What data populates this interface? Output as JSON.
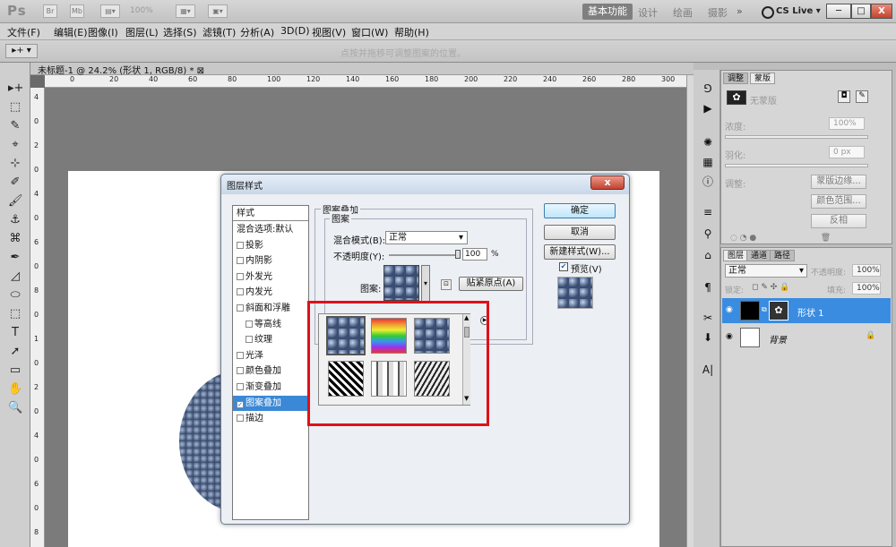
{
  "app": {
    "logo": "Ps",
    "zoom": "100%",
    "workspaces": [
      "基本功能",
      "设计",
      "绘画",
      "摄影"
    ],
    "more": "»",
    "cslive": "CS Live ▾",
    "win_min": "─",
    "win_max": "□",
    "win_close": "X"
  },
  "menu": [
    "文件(F)",
    "编辑(E)",
    "图像(I)",
    "图层(L)",
    "选择(S)",
    "滤镜(T)",
    "分析(A)",
    "3D(D)",
    "视图(V)",
    "窗口(W)",
    "帮助(H)"
  ],
  "options": {
    "tool": "▸+ ▾",
    "hint": "点按并拖移可调整图案的位置。"
  },
  "document": {
    "tab": "未标题-1 @ 24.2% (形状 1, RGB/8) * ⊠",
    "ruler_h": [
      "0",
      "20",
      "40",
      "60",
      "80",
      "100",
      "120",
      "140",
      "160",
      "180",
      "200",
      "220",
      "240",
      "260",
      "280",
      "300"
    ],
    "ruler_v": [
      "4",
      "0",
      "2",
      "0",
      "4",
      "0",
      "6",
      "0",
      "8",
      "0",
      "1",
      "0",
      "2",
      "0",
      "4",
      "0",
      "6",
      "0",
      "8"
    ]
  },
  "tools": [
    "▸+",
    "⬚",
    "✎",
    "⌖",
    "⊹",
    "✐",
    "🖌",
    "⚓",
    "⌘",
    "✒",
    "◿",
    "⬭",
    "⬚",
    "T",
    "➚",
    "▭",
    "✋",
    "🔍"
  ],
  "mask_panel": {
    "tabs": [
      "调整",
      "蒙版"
    ],
    "title": "无蒙版",
    "density_label": "浓度:",
    "density_value": "100%",
    "feather_label": "羽化:",
    "feather_value": "0 px",
    "refine_label": "调整:",
    "btn_edge": "蒙版边缘...",
    "btn_color": "颜色范围...",
    "btn_invert": "反相"
  },
  "layers_panel": {
    "tabs": [
      "图层",
      "通道",
      "路径"
    ],
    "blend": "正常",
    "opacity_label": "不透明度:",
    "opacity_value": "100%",
    "lock_label": "锁定:",
    "fill_label": "填充:",
    "fill_value": "100%",
    "layers": [
      {
        "name": "形状 1",
        "selected": true
      },
      {
        "name": "背景",
        "selected": false,
        "lock": "🔒"
      }
    ]
  },
  "dialog": {
    "title": "图层样式",
    "close": "x",
    "list_header": "样式",
    "items": [
      {
        "label": "混合选项:默认",
        "check": false,
        "indent": false,
        "plain": true
      },
      {
        "label": "投影",
        "check": false
      },
      {
        "label": "内阴影",
        "check": false
      },
      {
        "label": "外发光",
        "check": false
      },
      {
        "label": "内发光",
        "check": false
      },
      {
        "label": "斜面和浮雕",
        "check": false
      },
      {
        "label": "等高线",
        "check": false,
        "indent": true
      },
      {
        "label": "纹理",
        "check": false,
        "indent": true
      },
      {
        "label": "光泽",
        "check": false
      },
      {
        "label": "颜色叠加",
        "check": false
      },
      {
        "label": "渐变叠加",
        "check": false
      },
      {
        "label": "图案叠加",
        "check": true,
        "selected": true
      },
      {
        "label": "描边",
        "check": false
      }
    ],
    "group_title": "图案叠加",
    "subgroup_title": "图案",
    "blend_label": "混合模式(B):",
    "blend_value": "正常",
    "opacity_label": "不透明度(Y):",
    "opacity_value": "100",
    "opacity_unit": "%",
    "pattern_label": "图案:",
    "snap_btn": "贴紧原点(A)",
    "ok": "确定",
    "cancel": "取消",
    "new_style": "新建样式(W)...",
    "preview_label": "预览(V)",
    "preview_checked": true
  },
  "picker": {
    "patterns": [
      "bubbles",
      "rainbow",
      "bubbles",
      "cubes",
      "steps",
      "zebra"
    ]
  }
}
